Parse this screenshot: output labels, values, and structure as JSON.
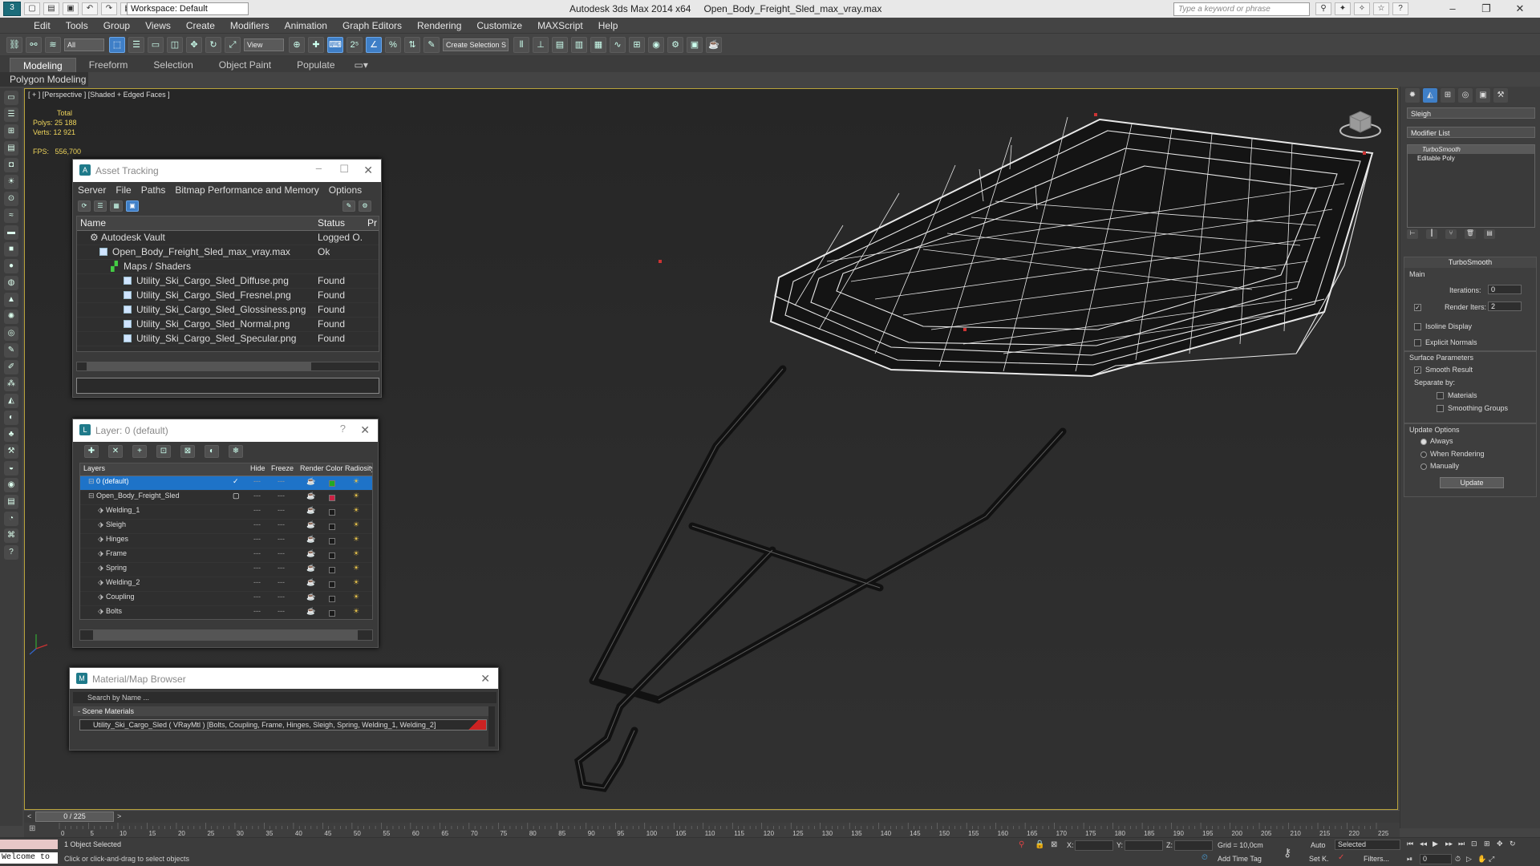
{
  "app": {
    "window_title": "Autodesk 3ds Max  2014 x64",
    "file_name": "Open_Body_Freight_Sled_max_vray.max",
    "workspace": "Workspace: Default",
    "search_placeholder": "Type a keyword or phrase"
  },
  "menu": [
    "Edit",
    "Tools",
    "Group",
    "Views",
    "Create",
    "Modifiers",
    "Animation",
    "Graph Editors",
    "Rendering",
    "Customize",
    "MAXScript",
    "Help"
  ],
  "toolbar": {
    "filter": "All",
    "view": "View",
    "selection_set": "Create Selection S"
  },
  "ribbon": {
    "tabs": [
      "Modeling",
      "Freeform",
      "Selection",
      "Object Paint",
      "Populate"
    ],
    "panel": "Polygon Modeling"
  },
  "viewport": {
    "label": "[ + ] [Perspective ] [Shaded + Edged Faces ]",
    "stats_total": "Total",
    "polys_label": "Polys:",
    "polys_value": "25 188",
    "verts_label": "Verts:",
    "verts_value": "12 921",
    "fps_label": "FPS:",
    "fps_value": "556,700"
  },
  "asset_tracking": {
    "title": "Asset Tracking",
    "menu": [
      "Server",
      "File",
      "Paths",
      "Bitmap Performance and Memory",
      "Options"
    ],
    "columns": [
      "Name",
      "Status",
      "Pr"
    ],
    "rows": [
      {
        "name": "Autodesk Vault",
        "status": "Logged O..."
      },
      {
        "name": "Open_Body_Freight_Sled_max_vray.max",
        "status": "Ok"
      },
      {
        "name": "Maps / Shaders",
        "status": ""
      },
      {
        "name": "Utility_Ski_Cargo_Sled_Diffuse.png",
        "status": "Found"
      },
      {
        "name": "Utility_Ski_Cargo_Sled_Fresnel.png",
        "status": "Found"
      },
      {
        "name": "Utility_Ski_Cargo_Sled_Glossiness.png",
        "status": "Found"
      },
      {
        "name": "Utility_Ski_Cargo_Sled_Normal.png",
        "status": "Found"
      },
      {
        "name": "Utility_Ski_Cargo_Sled_Specular.png",
        "status": "Found"
      }
    ]
  },
  "layers": {
    "title": "Layer: 0 (default)",
    "help": "?",
    "columns": [
      "Layers",
      "Hide",
      "Freeze",
      "Render",
      "Color",
      "Radiosity"
    ],
    "rows": [
      {
        "name": "0 (default)",
        "color": "#22aa22"
      },
      {
        "name": "Open_Body_Freight_Sled",
        "color": "#cc2244"
      },
      {
        "name": "Welding_1",
        "color": "#1a1a1a"
      },
      {
        "name": "Sleigh",
        "color": "#1a1a1a"
      },
      {
        "name": "Hinges",
        "color": "#1a1a1a"
      },
      {
        "name": "Frame",
        "color": "#1a1a1a"
      },
      {
        "name": "Spring",
        "color": "#1a1a1a"
      },
      {
        "name": "Welding_2",
        "color": "#1a1a1a"
      },
      {
        "name": "Coupling",
        "color": "#1a1a1a"
      },
      {
        "name": "Bolts",
        "color": "#1a1a1a"
      }
    ]
  },
  "material_browser": {
    "title": "Material/Map Browser",
    "search_placeholder": "Search by Name ...",
    "section": "- Scene Materials",
    "item": "Utility_Ski_Cargo_Sled  ( VRayMtl )  [Bolts, Coupling, Frame, Hinges, Sleigh, Spring, Welding_1, Welding_2]"
  },
  "command_panel": {
    "object_name": "Sleigh",
    "modifier_list": "Modifier List",
    "stack": [
      "TurboSmooth",
      "Editable Poly"
    ],
    "turbosmooth": {
      "title": "TurboSmooth",
      "main": "Main",
      "iterations_label": "Iterations:",
      "iterations": "0",
      "render_iters_label": "Render Iters:",
      "render_iters": "2",
      "isoline": "Isoline Display",
      "explicit_normals": "Explicit Normals",
      "surface_params": "Surface Parameters",
      "smooth_result": "Smooth Result",
      "separate_by": "Separate by:",
      "materials": "Materials",
      "smoothing_groups": "Smoothing Groups",
      "update_options": "Update Options",
      "always": "Always",
      "when_rendering": "When Rendering",
      "manually": "Manually",
      "update": "Update"
    }
  },
  "timeline": {
    "frame": "0 / 225",
    "ticks": [
      "0",
      "5",
      "10",
      "15",
      "20",
      "25",
      "30",
      "35",
      "40",
      "45",
      "50",
      "55",
      "60",
      "65",
      "70",
      "75",
      "80",
      "85",
      "90",
      "95",
      "100",
      "105",
      "110",
      "115",
      "120",
      "125",
      "130",
      "135",
      "140",
      "145",
      "150",
      "155",
      "160",
      "165",
      "170",
      "175",
      "180",
      "185",
      "190",
      "195",
      "200",
      "205",
      "210",
      "215",
      "220",
      "225"
    ]
  },
  "status": {
    "welcome": "Welcome to",
    "selection": "1 Object Selected",
    "prompt": "Click or click-and-drag to select objects",
    "x_label": "X:",
    "y_label": "Y:",
    "z_label": "Z:",
    "grid": "Grid = 10,0cm",
    "add_time_tag": "Add Time Tag",
    "auto": "Auto",
    "set_key": "Set K.",
    "selected": "Selected",
    "filters": "Filters...",
    "frame_field": "0"
  },
  "colors": {
    "accent": "#3f7fc7",
    "viewport_border": "#b9a33b",
    "stats": "#eed45b",
    "viewport_bg": "#2b2b2b"
  }
}
